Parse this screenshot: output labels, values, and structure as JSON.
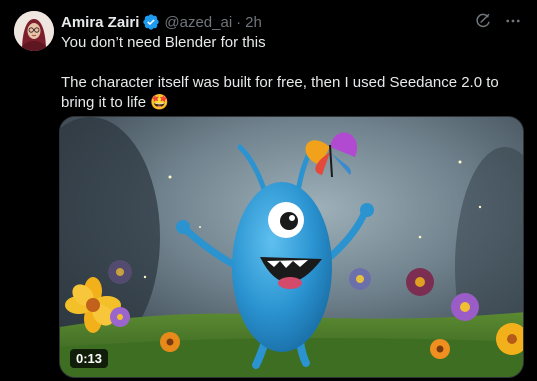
{
  "post": {
    "author_name": "Amira Zairi",
    "handle": "@azed_ai",
    "separator": "·",
    "time": "2h",
    "verified": true,
    "text_line1": "You don’t need Blender for this",
    "text_line2": "The character itself was built for free, then I used Seedance 2.0 to bring it to life 🤩",
    "video_duration": "0:13"
  },
  "icons": {
    "verified": "verified-badge-icon",
    "grok": "grok-icon",
    "more": "more-icon"
  },
  "colors": {
    "background": "#000000",
    "text": "#e7e9ea",
    "muted": "#71767b",
    "verified": "#1d9bf0"
  }
}
